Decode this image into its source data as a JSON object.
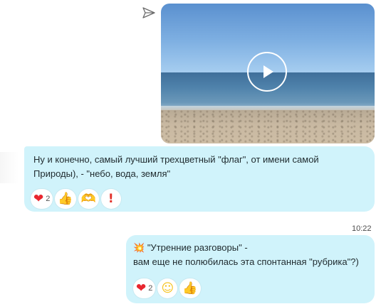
{
  "icons": {
    "forward": "forward-send-icon",
    "play": "play-icon"
  },
  "colors": {
    "bubble": "#d0f3fb",
    "reaction_bg": "#ffffff",
    "heart": "#e8262f",
    "thumb": "#f2b92b"
  },
  "messages": [
    {
      "lines": [
        "Ну и конечно, самый лучший трехцветный \"флаг\", от имени самой",
        "Природы), - \"небо, вода, земля\""
      ],
      "reactions": [
        {
          "emoji": "❤",
          "name": "heart",
          "count": "2"
        },
        {
          "emoji": "👍",
          "name": "thumbs-up",
          "count": ""
        },
        {
          "emoji": "🫶",
          "name": "heart-hands",
          "count": ""
        },
        {
          "emoji": "!",
          "name": "exclamation",
          "count": ""
        }
      ]
    },
    {
      "timestamp": "10:22",
      "prefix_emoji": "💥",
      "lines": [
        "\"Утренние разговоры\" -",
        "вам еще не полюбилась эта спонтанная \"рубрика\"?)"
      ],
      "reactions": [
        {
          "emoji": "❤",
          "name": "heart",
          "count": "2"
        },
        {
          "emoji": "☺",
          "name": "smile",
          "count": ""
        },
        {
          "emoji": "👍",
          "name": "thumbs-up",
          "count": ""
        }
      ]
    }
  ]
}
